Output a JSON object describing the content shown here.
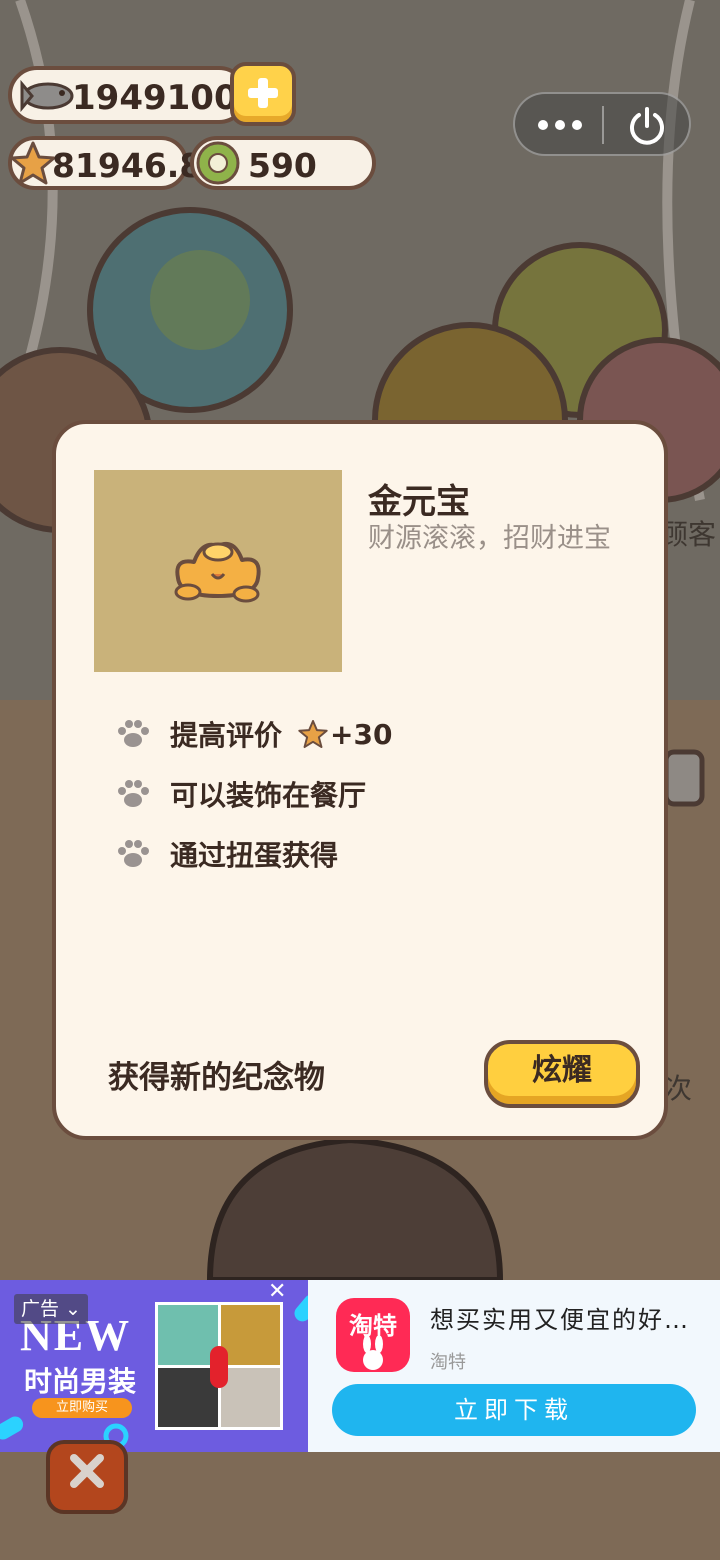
{
  "currency": {
    "fish": "1949100",
    "stars": "81946.8",
    "coins": "590"
  },
  "modal": {
    "item_name": "金元宝",
    "item_desc": "财源滚滚，招财进宝",
    "features": [
      {
        "text": "提高评价",
        "bonus": "+30"
      },
      {
        "text": "可以装饰在餐厅"
      },
      {
        "text": "通过扭蛋获得"
      }
    ],
    "footer_text": "获得新的纪念物",
    "share_label": "炫耀"
  },
  "background": {
    "side_text_1": "顾客",
    "side_text_2": "次"
  },
  "ad": {
    "label": "广告",
    "creative_new": "NEW",
    "creative_headline": "时尚男装",
    "creative_buy": "立即购买",
    "title": "想买实用又便宜的好…",
    "brand": "淘特",
    "download_label": "立即下载",
    "icon_text": "淘特"
  },
  "colors": {
    "accent_yellow": "#ffcf3f",
    "outline_brown": "#6b4d3e",
    "modal_bg": "#fdf5ea",
    "ad_button": "#1fb5ef"
  }
}
